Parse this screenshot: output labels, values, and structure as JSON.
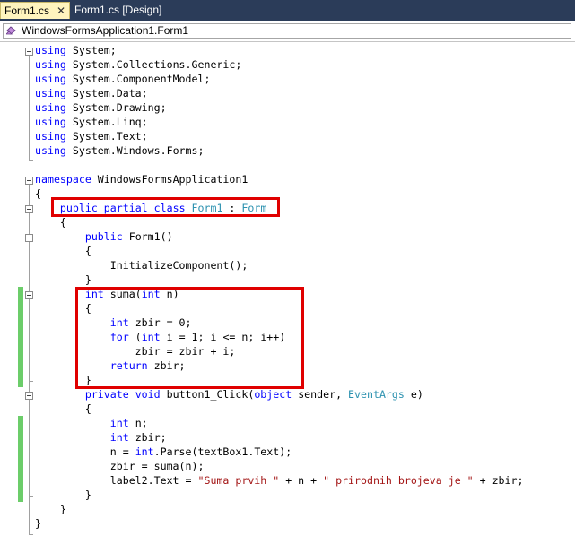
{
  "tabs": [
    {
      "label": "Form1.cs",
      "active": true,
      "close": "✕"
    },
    {
      "label": "Form1.cs [Design]",
      "active": false
    }
  ],
  "navigation": {
    "class_combo": "WindowsFormsApplication1.Form1"
  },
  "code_lines": [
    [
      {
        "t": "using",
        "c": "kw"
      },
      {
        "t": " System;"
      }
    ],
    [
      {
        "t": "using",
        "c": "kw"
      },
      {
        "t": " System.Collections.Generic;"
      }
    ],
    [
      {
        "t": "using",
        "c": "kw"
      },
      {
        "t": " System.ComponentModel;"
      }
    ],
    [
      {
        "t": "using",
        "c": "kw"
      },
      {
        "t": " System.Data;"
      }
    ],
    [
      {
        "t": "using",
        "c": "kw"
      },
      {
        "t": " System.Drawing;"
      }
    ],
    [
      {
        "t": "using",
        "c": "kw"
      },
      {
        "t": " System.Linq;"
      }
    ],
    [
      {
        "t": "using",
        "c": "kw"
      },
      {
        "t": " System.Text;"
      }
    ],
    [
      {
        "t": "using",
        "c": "kw"
      },
      {
        "t": " System.Windows.Forms;"
      }
    ],
    [],
    [
      {
        "t": "namespace",
        "c": "kw"
      },
      {
        "t": " WindowsFormsApplication1"
      }
    ],
    [
      {
        "t": "{"
      }
    ],
    [
      {
        "t": "    "
      },
      {
        "t": "public",
        "c": "kw"
      },
      {
        "t": " "
      },
      {
        "t": "partial",
        "c": "kw"
      },
      {
        "t": " "
      },
      {
        "t": "class",
        "c": "kw"
      },
      {
        "t": " "
      },
      {
        "t": "Form1",
        "c": "ty"
      },
      {
        "t": " : "
      },
      {
        "t": "Form",
        "c": "ty"
      }
    ],
    [
      {
        "t": "    {"
      }
    ],
    [
      {
        "t": "        "
      },
      {
        "t": "public",
        "c": "kw"
      },
      {
        "t": " Form1()"
      }
    ],
    [
      {
        "t": "        {"
      }
    ],
    [
      {
        "t": "            InitializeComponent();"
      }
    ],
    [
      {
        "t": "        }"
      }
    ],
    [
      {
        "t": "        "
      },
      {
        "t": "int",
        "c": "kw"
      },
      {
        "t": " suma("
      },
      {
        "t": "int",
        "c": "kw"
      },
      {
        "t": " n)"
      }
    ],
    [
      {
        "t": "        {"
      }
    ],
    [
      {
        "t": "            "
      },
      {
        "t": "int",
        "c": "kw"
      },
      {
        "t": " zbir = 0;"
      }
    ],
    [
      {
        "t": "            "
      },
      {
        "t": "for",
        "c": "kw"
      },
      {
        "t": " ("
      },
      {
        "t": "int",
        "c": "kw"
      },
      {
        "t": " i = 1; i <= n; i++)"
      }
    ],
    [
      {
        "t": "                zbir = zbir + i;"
      }
    ],
    [
      {
        "t": "            "
      },
      {
        "t": "return",
        "c": "kw"
      },
      {
        "t": " zbir;"
      }
    ],
    [
      {
        "t": "        }"
      }
    ],
    [
      {
        "t": "        "
      },
      {
        "t": "private",
        "c": "kw"
      },
      {
        "t": " "
      },
      {
        "t": "void",
        "c": "kw"
      },
      {
        "t": " button1_Click("
      },
      {
        "t": "object",
        "c": "kw"
      },
      {
        "t": " sender, "
      },
      {
        "t": "EventArgs",
        "c": "ty"
      },
      {
        "t": " e)"
      }
    ],
    [
      {
        "t": "        {"
      }
    ],
    [
      {
        "t": "            "
      },
      {
        "t": "int",
        "c": "kw"
      },
      {
        "t": " n;"
      }
    ],
    [
      {
        "t": "            "
      },
      {
        "t": "int",
        "c": "kw"
      },
      {
        "t": " zbir;"
      }
    ],
    [
      {
        "t": "            n = "
      },
      {
        "t": "int",
        "c": "kw"
      },
      {
        "t": ".Parse(textBox1.Text);"
      }
    ],
    [
      {
        "t": "            zbir = suma(n);"
      }
    ],
    [
      {
        "t": "            label2.Text = "
      },
      {
        "t": "\"Suma prvih \"",
        "c": "st"
      },
      {
        "t": " + n + "
      },
      {
        "t": "\" prirodnih brojeva je \"",
        "c": "st"
      },
      {
        "t": " + zbir;"
      }
    ],
    [
      {
        "t": "        }"
      }
    ],
    [
      {
        "t": "    }"
      }
    ],
    [
      {
        "t": "}"
      }
    ]
  ],
  "colors": {
    "keyword": "#0000ff",
    "type": "#2b91af",
    "string": "#a31515",
    "change_bar": "#6ccd6a",
    "highlight": "#e00000",
    "tab_strip": "#2b3c59",
    "active_tab": "#fff4be"
  }
}
